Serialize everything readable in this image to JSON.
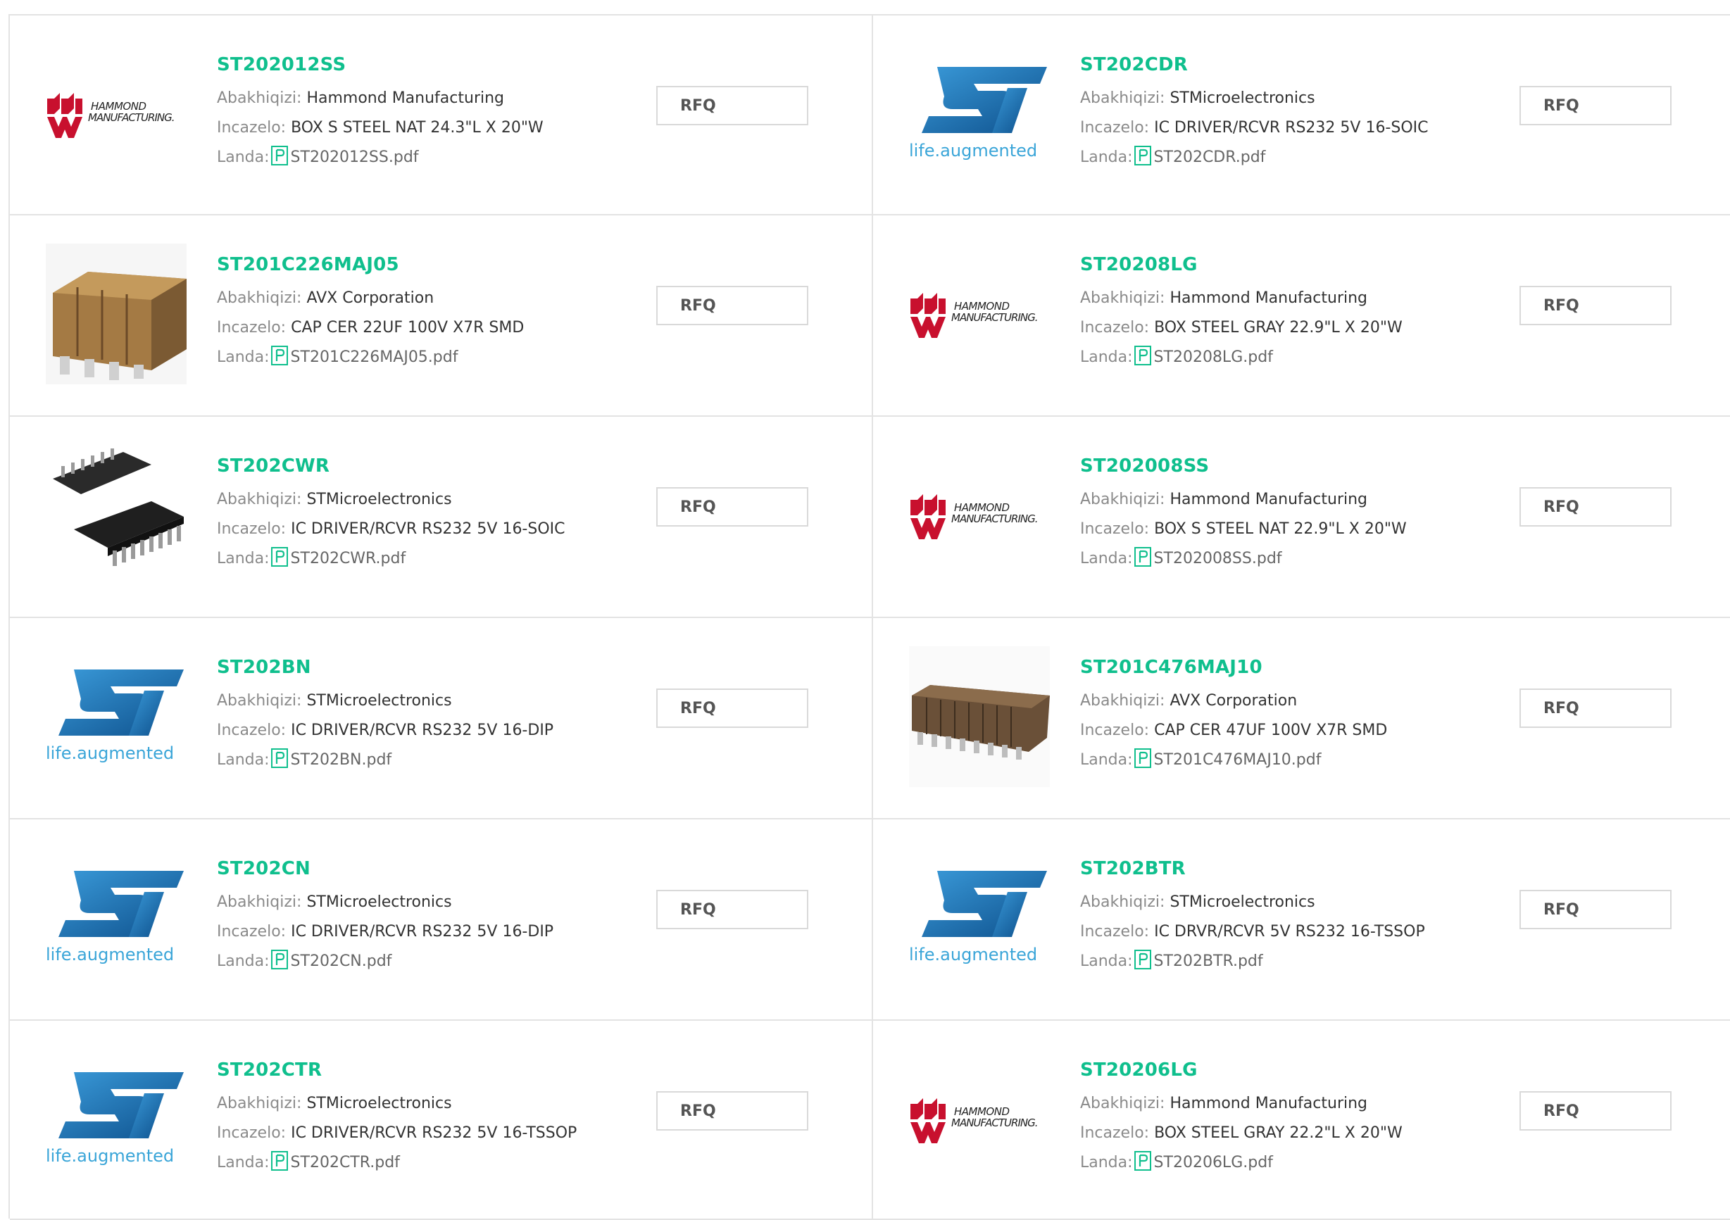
{
  "labels": {
    "manufacturer": "Abakhiqizi:",
    "description": "Incazelo:",
    "datasheet": "Landa:",
    "rfq": "RFQ"
  },
  "colors": {
    "part_link": "#0fbf8d",
    "st_blue": "#1d74b8",
    "st_tagline": "#3aa5d8",
    "hammond_red": "#c8102e"
  },
  "logos": {
    "hammond": {
      "line1": "HAMMOND",
      "line2": "MANUFACTURING."
    },
    "st": {
      "tagline": "life.augmented"
    }
  },
  "products": [
    {
      "part": "ST202012SS",
      "manufacturer": "Hammond Manufacturing",
      "description": "BOX S STEEL NAT 24.3\"L X 20\"W",
      "datasheet": "ST202012SS.pdf",
      "image": "hammond-logo"
    },
    {
      "part": "ST202CDR",
      "manufacturer": "STMicroelectronics",
      "description": "IC DRIVER/RCVR RS232 5V 16-SOIC",
      "datasheet": "ST202CDR.pdf",
      "image": "st-logo"
    },
    {
      "part": "ST201C226MAJ05",
      "manufacturer": "AVX Corporation",
      "description": "CAP CER 22UF 100V X7R SMD",
      "datasheet": "ST201C226MAJ05.pdf",
      "image": "capacitor-stack-photo"
    },
    {
      "part": "ST20208LG",
      "manufacturer": "Hammond Manufacturing",
      "description": "BOX STEEL GRAY 22.9\"L X 20\"W",
      "datasheet": "ST20208LG.pdf",
      "image": "hammond-logo"
    },
    {
      "part": "ST202CWR",
      "manufacturer": "STMicroelectronics",
      "description": "IC DRIVER/RCVR RS232 5V 16-SOIC",
      "datasheet": "ST202CWR.pdf",
      "image": "soic-chip-photo"
    },
    {
      "part": "ST202008SS",
      "manufacturer": "Hammond Manufacturing",
      "description": "BOX S STEEL NAT 22.9\"L X 20\"W",
      "datasheet": "ST202008SS.pdf",
      "image": "hammond-logo"
    },
    {
      "part": "ST202BN",
      "manufacturer": "STMicroelectronics",
      "description": "IC DRIVER/RCVR RS232 5V 16-DIP",
      "datasheet": "ST202BN.pdf",
      "image": "st-logo"
    },
    {
      "part": "ST201C476MAJ10",
      "manufacturer": "AVX Corporation",
      "description": "CAP CER 47UF 100V X7R SMD",
      "datasheet": "ST201C476MAJ10.pdf",
      "image": "capacitor-strip-photo"
    },
    {
      "part": "ST202CN",
      "manufacturer": "STMicroelectronics",
      "description": "IC DRIVER/RCVR RS232 5V 16-DIP",
      "datasheet": "ST202CN.pdf",
      "image": "st-logo"
    },
    {
      "part": "ST202BTR",
      "manufacturer": "STMicroelectronics",
      "description": "IC DRVR/RCVR 5V RS232 16-TSSOP",
      "datasheet": "ST202BTR.pdf",
      "image": "st-logo"
    },
    {
      "part": "ST202CTR",
      "manufacturer": "STMicroelectronics",
      "description": "IC DRIVER/RCVR RS232 5V 16-TSSOP",
      "datasheet": "ST202CTR.pdf",
      "image": "st-logo"
    },
    {
      "part": "ST20206LG",
      "manufacturer": "Hammond Manufacturing",
      "description": "BOX STEEL GRAY 22.2\"L X 20\"W",
      "datasheet": "ST20206LG.pdf",
      "image": "hammond-logo"
    }
  ]
}
